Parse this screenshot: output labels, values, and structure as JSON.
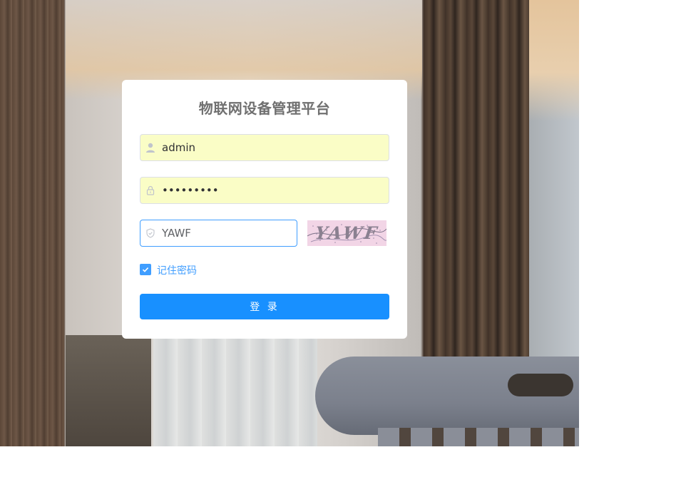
{
  "login": {
    "title": "物联网设备管理平台",
    "username_value": "admin",
    "password_value": "•••••••••",
    "captcha_input_value": "YAWF",
    "captcha_image_text": "YAWF",
    "remember_label": "记住密码",
    "remember_checked": true,
    "submit_label": "登 录"
  },
  "icons": {
    "username": "user-icon",
    "password": "lock-icon",
    "captcha": "shield-icon",
    "checkbox": "check-icon"
  },
  "colors": {
    "primary": "#1890ff",
    "focus_border": "#409eff",
    "autofill_bg": "#fafdc6",
    "title": "#707070"
  }
}
